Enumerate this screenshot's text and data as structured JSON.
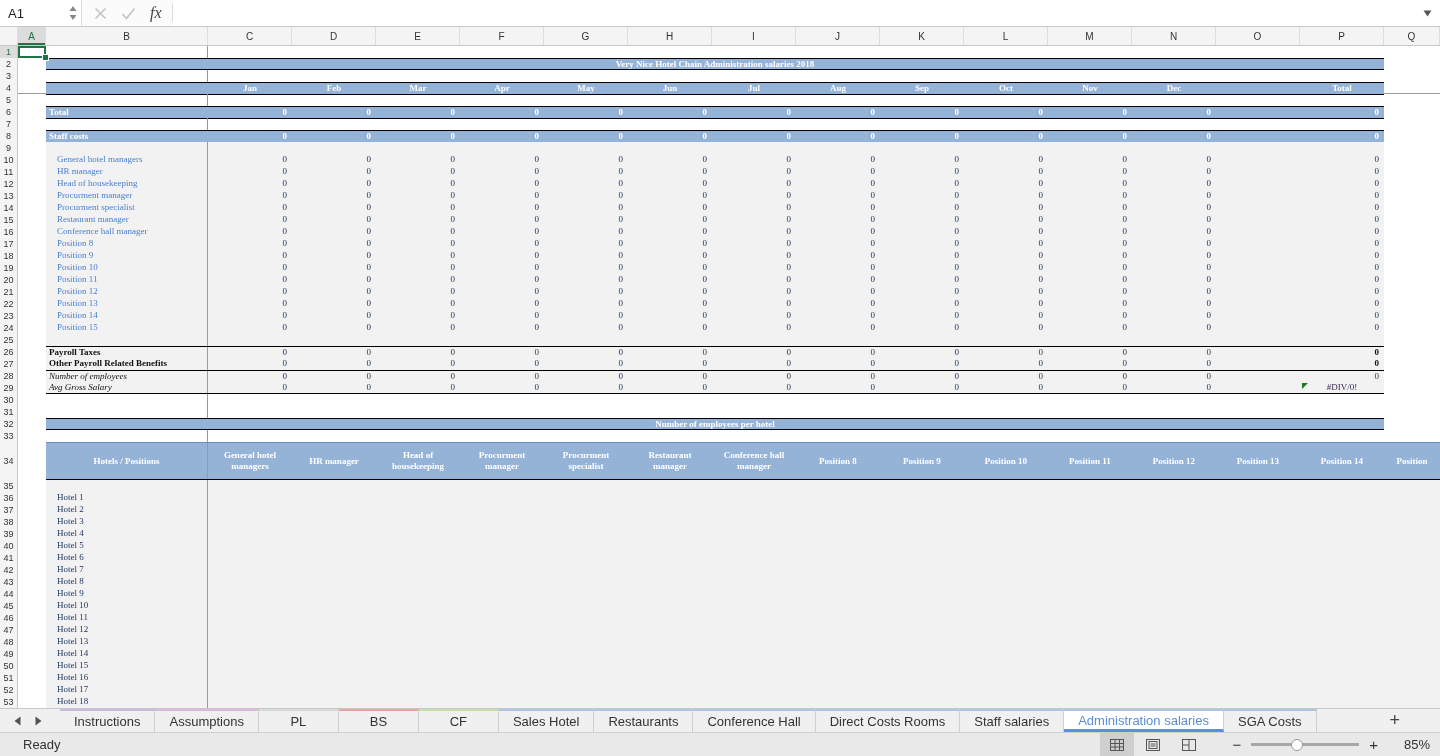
{
  "formula_bar": {
    "name_box": "A1",
    "function_label": "fx"
  },
  "column_headers": [
    {
      "label": "A",
      "selected": true
    },
    {
      "label": "B",
      "selected": false
    },
    {
      "label": "C",
      "selected": false
    },
    {
      "label": "D",
      "selected": false
    },
    {
      "label": "E",
      "selected": false
    },
    {
      "label": "F",
      "selected": false
    },
    {
      "label": "G",
      "selected": false
    },
    {
      "label": "H",
      "selected": false
    },
    {
      "label": "I",
      "selected": false
    },
    {
      "label": "J",
      "selected": false
    },
    {
      "label": "K",
      "selected": false
    },
    {
      "label": "L",
      "selected": false
    },
    {
      "label": "M",
      "selected": false
    },
    {
      "label": "N",
      "selected": false
    },
    {
      "label": "O",
      "selected": false
    },
    {
      "label": "P",
      "selected": false
    },
    {
      "label": "Q",
      "selected": false
    }
  ],
  "row_numbers": [
    {
      "label": "1",
      "selected": true
    },
    {
      "label": "2",
      "selected": false
    },
    {
      "label": "3",
      "selected": false
    },
    {
      "label": "4",
      "selected": false
    },
    {
      "label": "5",
      "selected": false
    },
    {
      "label": "6",
      "selected": false
    },
    {
      "label": "7",
      "selected": false
    },
    {
      "label": "8",
      "selected": false
    },
    {
      "label": "9",
      "selected": false
    },
    {
      "label": "10",
      "selected": false
    },
    {
      "label": "11",
      "selected": false
    },
    {
      "label": "12",
      "selected": false
    },
    {
      "label": "13",
      "selected": false
    },
    {
      "label": "14",
      "selected": false
    },
    {
      "label": "15",
      "selected": false
    },
    {
      "label": "16",
      "selected": false
    },
    {
      "label": "17",
      "selected": false
    },
    {
      "label": "18",
      "selected": false
    },
    {
      "label": "19",
      "selected": false
    },
    {
      "label": "20",
      "selected": false
    },
    {
      "label": "21",
      "selected": false
    },
    {
      "label": "22",
      "selected": false
    },
    {
      "label": "23",
      "selected": false
    },
    {
      "label": "24",
      "selected": false
    },
    {
      "label": "25",
      "selected": false
    },
    {
      "label": "26",
      "selected": false
    },
    {
      "label": "27",
      "selected": false
    },
    {
      "label": "28",
      "selected": false
    },
    {
      "label": "29",
      "selected": false
    },
    {
      "label": "30",
      "selected": false
    },
    {
      "label": "31",
      "selected": false
    },
    {
      "label": "32",
      "selected": false
    },
    {
      "label": "33",
      "selected": false
    },
    {
      "label": "34",
      "selected": false
    },
    {
      "label": "35",
      "selected": false
    },
    {
      "label": "36",
      "selected": false
    },
    {
      "label": "37",
      "selected": false
    },
    {
      "label": "38",
      "selected": false
    },
    {
      "label": "39",
      "selected": false
    },
    {
      "label": "40",
      "selected": false
    },
    {
      "label": "41",
      "selected": false
    },
    {
      "label": "42",
      "selected": false
    },
    {
      "label": "43",
      "selected": false
    },
    {
      "label": "44",
      "selected": false
    },
    {
      "label": "45",
      "selected": false
    },
    {
      "label": "46",
      "selected": false
    },
    {
      "label": "47",
      "selected": false
    },
    {
      "label": "48",
      "selected": false
    },
    {
      "label": "49",
      "selected": false
    },
    {
      "label": "50",
      "selected": false
    },
    {
      "label": "51",
      "selected": false
    },
    {
      "label": "52",
      "selected": false
    },
    {
      "label": "53",
      "selected": false
    }
  ],
  "title": "Very Nice Hotel Chain Administration salaries 2018",
  "months": [
    "Jan",
    "Feb",
    "Mar",
    "Apr",
    "May",
    "Jun",
    "Jul",
    "Aug",
    "Sep",
    "Oct",
    "Nov",
    "Dec"
  ],
  "total_header": "Total",
  "total_row": {
    "label": "Total",
    "values": [
      "0",
      "0",
      "0",
      "0",
      "0",
      "0",
      "0",
      "0",
      "0",
      "0",
      "0",
      "0"
    ],
    "total": "0"
  },
  "staff_costs_row": {
    "label": "Staff costs",
    "values": [
      "0",
      "0",
      "0",
      "0",
      "0",
      "0",
      "0",
      "0",
      "0",
      "0",
      "0",
      "0"
    ],
    "total": "0"
  },
  "positions": [
    {
      "label": "General hotel managers",
      "values": [
        "0",
        "0",
        "0",
        "0",
        "0",
        "0",
        "0",
        "0",
        "0",
        "0",
        "0",
        "0"
      ],
      "total": "0"
    },
    {
      "label": "HR manager",
      "values": [
        "0",
        "0",
        "0",
        "0",
        "0",
        "0",
        "0",
        "0",
        "0",
        "0",
        "0",
        "0"
      ],
      "total": "0"
    },
    {
      "label": "Head of housekeeping",
      "values": [
        "0",
        "0",
        "0",
        "0",
        "0",
        "0",
        "0",
        "0",
        "0",
        "0",
        "0",
        "0"
      ],
      "total": "0"
    },
    {
      "label": "Procurment manager",
      "values": [
        "0",
        "0",
        "0",
        "0",
        "0",
        "0",
        "0",
        "0",
        "0",
        "0",
        "0",
        "0"
      ],
      "total": "0"
    },
    {
      "label": "Procurment specialist",
      "values": [
        "0",
        "0",
        "0",
        "0",
        "0",
        "0",
        "0",
        "0",
        "0",
        "0",
        "0",
        "0"
      ],
      "total": "0"
    },
    {
      "label": "Restaurant manager",
      "values": [
        "0",
        "0",
        "0",
        "0",
        "0",
        "0",
        "0",
        "0",
        "0",
        "0",
        "0",
        "0"
      ],
      "total": "0"
    },
    {
      "label": "Conference hall manager",
      "values": [
        "0",
        "0",
        "0",
        "0",
        "0",
        "0",
        "0",
        "0",
        "0",
        "0",
        "0",
        "0"
      ],
      "total": "0"
    },
    {
      "label": "Position 8",
      "values": [
        "0",
        "0",
        "0",
        "0",
        "0",
        "0",
        "0",
        "0",
        "0",
        "0",
        "0",
        "0"
      ],
      "total": "0"
    },
    {
      "label": "Position 9",
      "values": [
        "0",
        "0",
        "0",
        "0",
        "0",
        "0",
        "0",
        "0",
        "0",
        "0",
        "0",
        "0"
      ],
      "total": "0"
    },
    {
      "label": "Position 10",
      "values": [
        "0",
        "0",
        "0",
        "0",
        "0",
        "0",
        "0",
        "0",
        "0",
        "0",
        "0",
        "0"
      ],
      "total": "0"
    },
    {
      "label": "Position 11",
      "values": [
        "0",
        "0",
        "0",
        "0",
        "0",
        "0",
        "0",
        "0",
        "0",
        "0",
        "0",
        "0"
      ],
      "total": "0"
    },
    {
      "label": "Position 12",
      "values": [
        "0",
        "0",
        "0",
        "0",
        "0",
        "0",
        "0",
        "0",
        "0",
        "0",
        "0",
        "0"
      ],
      "total": "0"
    },
    {
      "label": "Position 13",
      "values": [
        "0",
        "0",
        "0",
        "0",
        "0",
        "0",
        "0",
        "0",
        "0",
        "0",
        "0",
        "0"
      ],
      "total": "0"
    },
    {
      "label": "Position 14",
      "values": [
        "0",
        "0",
        "0",
        "0",
        "0",
        "0",
        "0",
        "0",
        "0",
        "0",
        "0",
        "0"
      ],
      "total": "0"
    },
    {
      "label": "Position 15",
      "values": [
        "0",
        "0",
        "0",
        "0",
        "0",
        "0",
        "0",
        "0",
        "0",
        "0",
        "0",
        "0"
      ],
      "total": "0"
    }
  ],
  "summary_rows": [
    {
      "label": "Payroll Taxes",
      "kind": "bold",
      "values": [
        "0",
        "0",
        "0",
        "0",
        "0",
        "0",
        "0",
        "0",
        "0",
        "0",
        "0",
        "0"
      ],
      "total": "0",
      "warning": false
    },
    {
      "label": "Other Payroll Related Benefits",
      "kind": "bold",
      "values": [
        "0",
        "0",
        "0",
        "0",
        "0",
        "0",
        "0",
        "0",
        "0",
        "0",
        "0",
        "0"
      ],
      "total": "0",
      "warning": false
    },
    {
      "label": "Number of employees",
      "kind": "italic",
      "values": [
        "0",
        "0",
        "0",
        "0",
        "0",
        "0",
        "0",
        "0",
        "0",
        "0",
        "0",
        "0"
      ],
      "total": "0",
      "warning": false
    },
    {
      "label": "Avg Gross Salary",
      "kind": "italic",
      "values": [
        "0",
        "0",
        "0",
        "0",
        "0",
        "0",
        "0",
        "0",
        "0",
        "0",
        "0",
        "0"
      ],
      "total": "#DIV/0!",
      "warning": true
    }
  ],
  "section_title": "Number of employees per hotel",
  "hotel_table": {
    "columns": [
      "Hotels / Positions",
      "General hotel managers",
      "HR manager",
      "Head of housekeeping",
      "Procurment manager",
      "Procurment specialist",
      "Restaurant manager",
      "Conference hall manager",
      "Position 8",
      "Position 9",
      "Position 10",
      "Position 11",
      "Position 12",
      "Position 13",
      "Position 14",
      "Position"
    ],
    "rows": [
      "Hotel 1",
      "Hotel 2",
      "Hotel 3",
      "Hotel 4",
      "Hotel 5",
      "Hotel 6",
      "Hotel 7",
      "Hotel 8",
      "Hotel 9",
      "Hotel 10",
      "Hotel 11",
      "Hotel 12",
      "Hotel 13",
      "Hotel 14",
      "Hotel 15",
      "Hotel 16",
      "Hotel 17",
      "Hotel 18"
    ]
  },
  "sheet_tabs": [
    {
      "label": "Instructions",
      "selected": false,
      "color": "#cbb9e0"
    },
    {
      "label": "Assumptions",
      "selected": false,
      "color": "#dcb8d8"
    },
    {
      "label": "PL",
      "selected": false,
      "color": "#d9d9d9"
    },
    {
      "label": "BS",
      "selected": false,
      "color": "#e9a3a3"
    },
    {
      "label": "CF",
      "selected": false,
      "color": "#c7e0a9"
    },
    {
      "label": "Sales Hotel",
      "selected": false,
      "color": "#aec6e6"
    },
    {
      "label": "Restaurants",
      "selected": false,
      "color": "#aec6e6"
    },
    {
      "label": "Conference Hall",
      "selected": false,
      "color": "#aec6e6"
    },
    {
      "label": "Direct Costs Rooms",
      "selected": false,
      "color": "#aec6e6"
    },
    {
      "label": "Staff salaries",
      "selected": false,
      "color": "#aec6e6"
    },
    {
      "label": "Administration salaries",
      "selected": true,
      "color": "#aec6e6"
    },
    {
      "label": "SGA Costs",
      "selected": false,
      "color": "#aec6e6"
    }
  ],
  "add_sheet": "+",
  "status_bar": {
    "status": "Ready",
    "views": [
      {
        "kind": "normal",
        "selected": true
      },
      {
        "kind": "page_layout",
        "selected": false
      },
      {
        "kind": "page_break",
        "selected": false
      }
    ],
    "zoom_out": "−",
    "zoom_in": "+",
    "zoom": {
      "level": 0.41
    },
    "zoom_label": "85%"
  }
}
